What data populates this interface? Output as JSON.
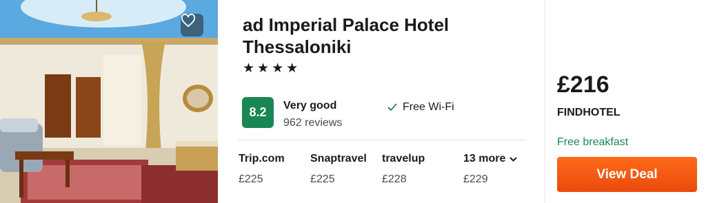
{
  "hotel": {
    "name": "ad Imperial Palace Hotel Thessaloniki",
    "stars": "★★★★",
    "rating": "8.2",
    "rating_label": "Very good",
    "reviews": "962 reviews",
    "amenity": "Free Wi-Fi"
  },
  "offers": [
    {
      "provider": "Trip.com",
      "price": "£225"
    },
    {
      "provider": "Snaptravel",
      "price": "£225"
    },
    {
      "provider": "travelup",
      "price": "£228"
    }
  ],
  "more_offers": {
    "label": "13 more",
    "price": "£229"
  },
  "deal": {
    "price": "£216",
    "provider": "FINDHOTEL",
    "perk": "Free breakfast",
    "button": "View Deal"
  },
  "icons": {
    "favorite": "heart-icon",
    "amenity": "check-icon",
    "more": "chevron-down-icon"
  },
  "colors": {
    "rating_badge": "#198754",
    "perk_text": "#198754",
    "deal_button": "#ea4a0c"
  }
}
